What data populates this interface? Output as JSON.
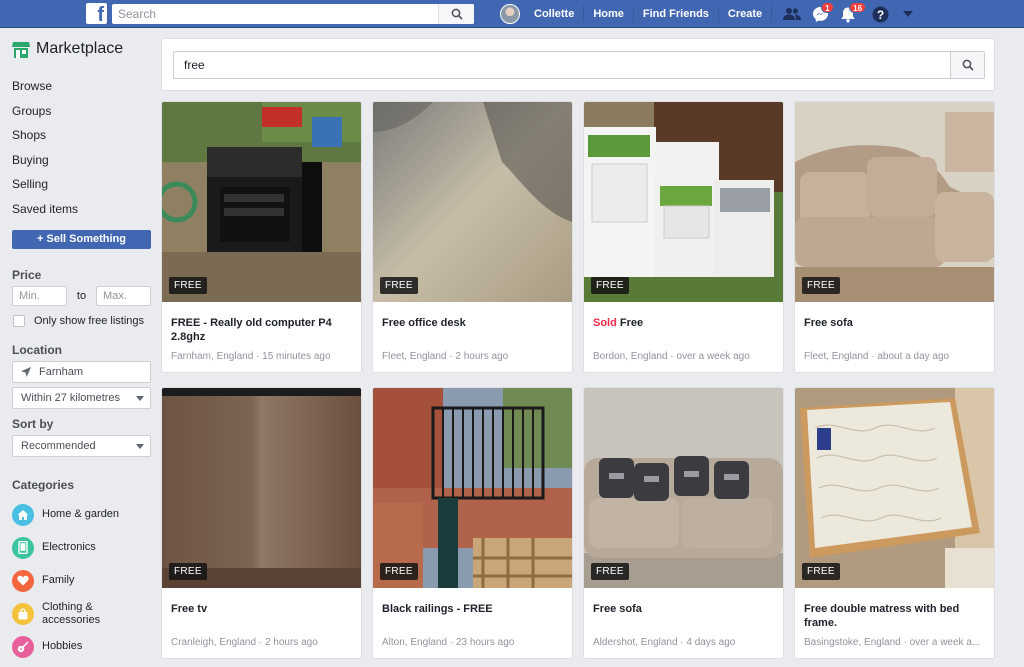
{
  "topbar": {
    "logo": "f",
    "search_placeholder": "Search",
    "user_name": "Collette",
    "nav": [
      "Home",
      "Find Friends",
      "Create"
    ],
    "messages_badge": "1",
    "notifications_badge": "16"
  },
  "sidebar": {
    "title": "Marketplace",
    "links": [
      "Browse",
      "Groups",
      "Shops",
      "Buying",
      "Selling",
      "Saved items"
    ],
    "sell_button": "+ Sell Something",
    "price": {
      "heading": "Price",
      "min_placeholder": "Min.",
      "to": "to",
      "max_placeholder": "Max.",
      "free_only": "Only show free listings"
    },
    "location": {
      "heading": "Location",
      "place": "Farnham",
      "radius": "Within 27 kilometres"
    },
    "sort": {
      "heading": "Sort by",
      "value": "Recommended"
    },
    "categories": {
      "heading": "Categories",
      "items": [
        {
          "label": "Home & garden",
          "icon": "house-icon",
          "color": "#48bfe3"
        },
        {
          "label": "Electronics",
          "icon": "tablet-icon",
          "color": "#3cc4a0"
        },
        {
          "label": "Family",
          "icon": "heart-icon",
          "color": "#f3663f"
        },
        {
          "label": "Clothing & accessories",
          "icon": "bag-icon",
          "color": "#f5c33b"
        },
        {
          "label": "Hobbies",
          "icon": "guitar-icon",
          "color": "#e8609a"
        }
      ]
    }
  },
  "main": {
    "query": "free",
    "tag": "FREE",
    "listings": [
      {
        "sold": "",
        "title": "FREE - Really old computer P4 2.8ghz",
        "meta": "Farnham, England · 15 minutes ago"
      },
      {
        "sold": "",
        "title": "Free office desk",
        "meta": "Fleet, England · 2 hours ago"
      },
      {
        "sold": "Sold",
        "title": "Free",
        "meta": "Bordon, England · over a week ago"
      },
      {
        "sold": "",
        "title": "Free sofa",
        "meta": "Fleet, England · about a day ago"
      },
      {
        "sold": "",
        "title": "Free tv",
        "meta": "Cranleigh, England · 2 hours ago"
      },
      {
        "sold": "",
        "title": "Black railings - FREE",
        "meta": "Alton, England · 23 hours ago"
      },
      {
        "sold": "",
        "title": "Free sofa",
        "meta": "Aldershot, England · 4 days ago"
      },
      {
        "sold": "",
        "title": "Free double matress with bed frame.",
        "meta": "Basingstoke, England · over a week a..."
      }
    ]
  },
  "colors": {
    "brand": "#4267b2",
    "sold": "#f02849"
  }
}
